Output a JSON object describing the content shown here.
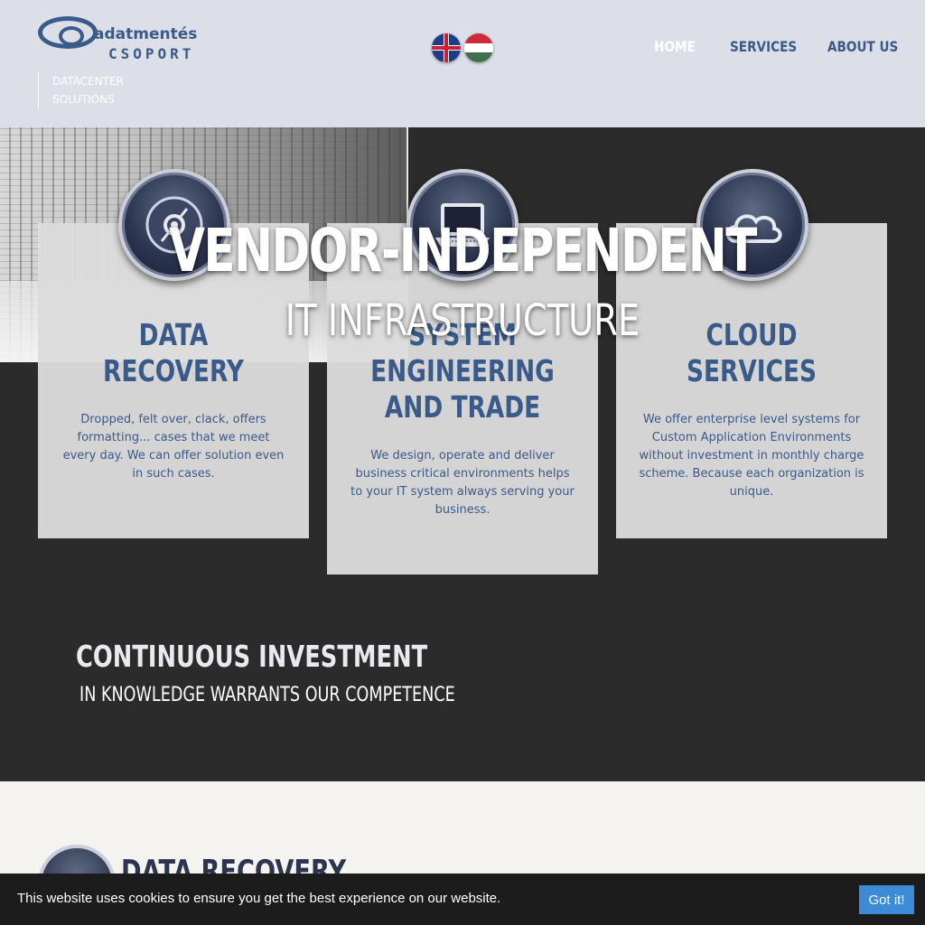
{
  "header": {
    "logo_name": "adatmentés",
    "logo_group": "CSOPORT",
    "tagline_line1": "DATACENTER",
    "tagline_line2": "SOLUTIONS",
    "nav": [
      {
        "label": "HOME"
      },
      {
        "label": "SERVICES"
      },
      {
        "label": "ABOUT US"
      }
    ]
  },
  "hero": {
    "title_line1": "VENDOR-INDEPENDENT",
    "title_line2": "IT INFRASTRUCTURE"
  },
  "services": [
    {
      "title": "DATA\nRECOVERY",
      "icon": "disc-icon",
      "text": "Dropped, felt over, clack, offers formatting... cases that we meet every day. We can offer solution even in such cases."
    },
    {
      "title": "SYSTEM\nENGINEERING\nAND TRADE",
      "icon": "laptop-icon",
      "text": "We design, operate and deliver business critical environments helps to your IT system always serving your business."
    },
    {
      "title": "CLOUD\nSERVICES",
      "icon": "cloud-icon",
      "text": "We offer enterprise level systems for Custom Application Environments without investment in monthly charge scheme. Because each organization is unique."
    }
  ],
  "investment": {
    "line1": "CONTINUOUS INVESTMENT",
    "line2": "IN KNOWLEDGE WARRANTS OUR COMPETENCE"
  },
  "lower": {
    "title": "DATA RECOVERY"
  },
  "cookie": {
    "text": "This website uses cookies to ensure you get the best experience on our website.",
    "button": "Got it!"
  },
  "colors": {
    "header_bg": "#dcdee8",
    "brand_blue": "#3a5a8a",
    "dark_bg": "#2b2b2b",
    "cookie_button": "#3d8bd6"
  }
}
